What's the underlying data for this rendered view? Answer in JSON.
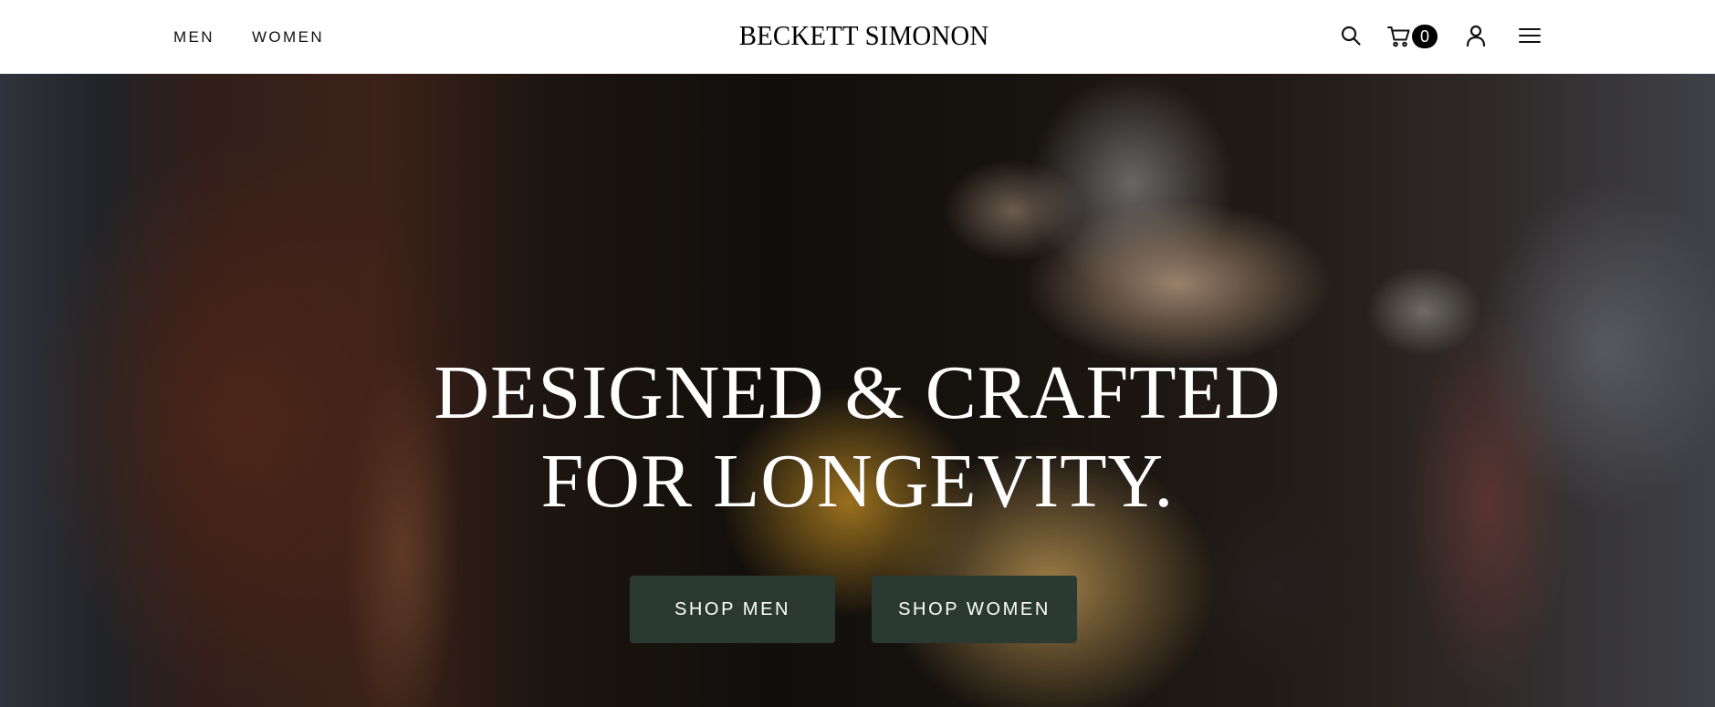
{
  "header": {
    "nav_left": [
      {
        "label": "MEN"
      },
      {
        "label": "WOMEN"
      }
    ],
    "logo": "BECKETT SIMONON",
    "icons": {
      "search": "search-icon",
      "cart": "cart-icon",
      "account": "user-icon",
      "menu": "hamburger-menu-icon"
    },
    "cart_count": "0"
  },
  "hero": {
    "title_line1": "DESIGNED & CRAFTED",
    "title_line2": "FOR LONGEVITY.",
    "buttons": [
      {
        "label": "SHOP MEN"
      },
      {
        "label": "SHOP WOMEN"
      }
    ],
    "button_color": "#2a3a33"
  }
}
